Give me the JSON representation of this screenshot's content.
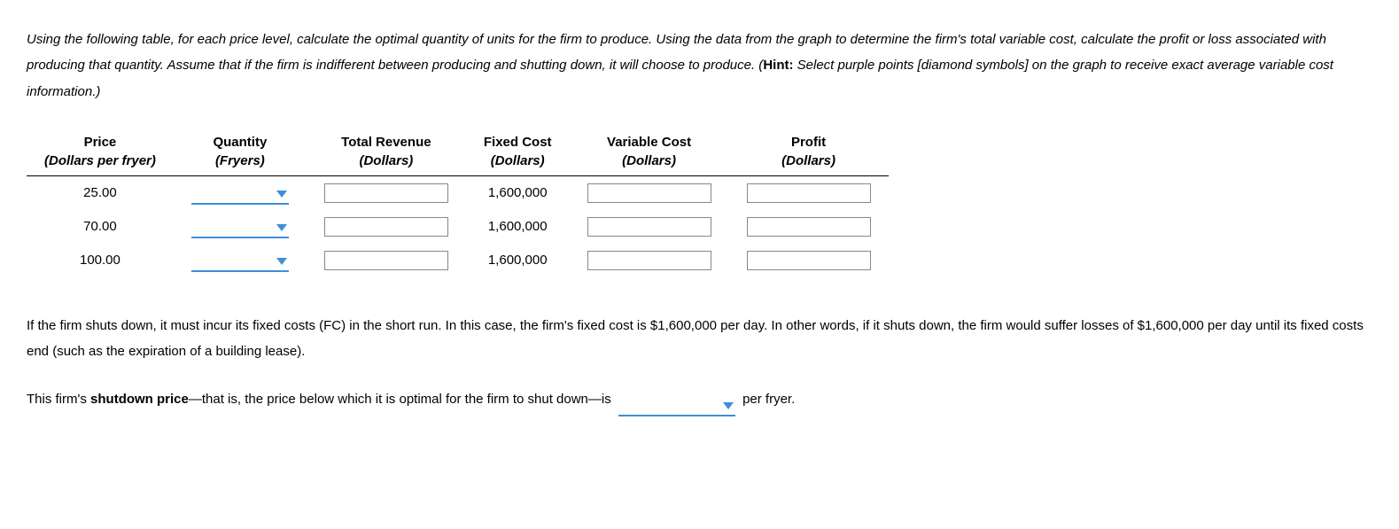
{
  "instructions": {
    "text_before_hint": "Using the following table, for each price level, calculate the optimal quantity of units for the firm to produce. Using the data from the graph to determine the firm's total variable cost, calculate the profit or loss associated with producing that quantity. Assume that if the firm is indifferent between producing and shutting down, it will choose to produce. (",
    "hint_label": "Hint:",
    "text_after_hint": " Select purple points [diamond symbols] on the graph to receive exact average variable cost information.)"
  },
  "table": {
    "headers": {
      "price": {
        "main": "Price",
        "sub": "(Dollars per fryer)"
      },
      "quantity": {
        "main": "Quantity",
        "sub": "(Fryers)"
      },
      "total_revenue": {
        "main": "Total Revenue",
        "sub": "(Dollars)"
      },
      "fixed_cost": {
        "main": "Fixed Cost",
        "sub": "(Dollars)"
      },
      "variable_cost": {
        "main": "Variable Cost",
        "sub": "(Dollars)"
      },
      "profit": {
        "main": "Profit",
        "sub": "(Dollars)"
      }
    },
    "rows": [
      {
        "price": "25.00",
        "quantity": "",
        "total_revenue": "",
        "fixed_cost": "1,600,000",
        "variable_cost": "",
        "profit": ""
      },
      {
        "price": "70.00",
        "quantity": "",
        "total_revenue": "",
        "fixed_cost": "1,600,000",
        "variable_cost": "",
        "profit": ""
      },
      {
        "price": "100.00",
        "quantity": "",
        "total_revenue": "",
        "fixed_cost": "1,600,000",
        "variable_cost": "",
        "profit": ""
      }
    ]
  },
  "paragraph": "If the firm shuts down, it must incur its fixed costs (FC) in the short run. In this case, the firm's fixed cost is $1,600,000 per day. In other words, if it shuts down, the firm would suffer losses of $1,600,000 per day until its fixed costs end (such as the expiration of a building lease).",
  "shutdown": {
    "before": "This firm's ",
    "bold": "shutdown price",
    "middle": "—that is, the price below which it is optimal for the firm to shut down—is",
    "selected": "",
    "after": " per fryer."
  }
}
